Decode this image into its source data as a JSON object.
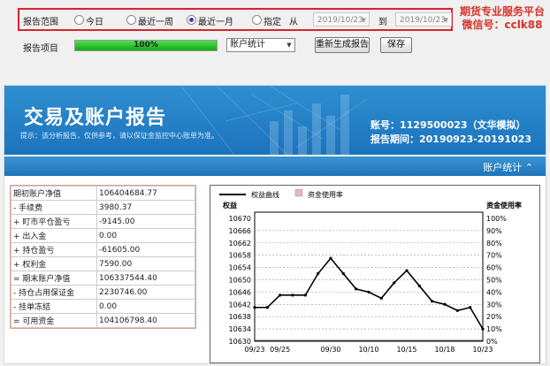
{
  "toolbar": {
    "range_label": "报告范围",
    "options": [
      {
        "label": "今日",
        "selected": false
      },
      {
        "label": "最近一周",
        "selected": false
      },
      {
        "label": "最近一月",
        "selected": true
      },
      {
        "label": "指定",
        "selected": false
      }
    ],
    "from_label": "从",
    "from_date": "2019/10/23",
    "to_label": "到",
    "to_date": "2019/10/23",
    "project_label": "报告项目",
    "progress_text": "100%",
    "progress": 1.0,
    "project_select": "账户统计",
    "regen_button": "重新生成报告",
    "save_button": "保存"
  },
  "watermark": {
    "line1": "期货专业服务平台",
    "line2": "微信号：cclk88"
  },
  "report": {
    "title": "交易及账户报告",
    "tip": "提示：该分析报告，仅供参考，请以保证金监控中心账单为准。",
    "account": "账号：1129500023（文华模拟）",
    "period": "报告期间：20190923-20191023",
    "section": "账户统计 ⌃"
  },
  "accounts": [
    {
      "k": "期初账户净值",
      "v": "106404684.77"
    },
    {
      "k": "- 手续费",
      "v": "3980.37"
    },
    {
      "k": "+ 盯市平仓盈亏",
      "v": "-9145.00"
    },
    {
      "k": "+ 出入金",
      "v": "0.00"
    },
    {
      "k": "+ 持仓盈亏",
      "v": "-61605.00"
    },
    {
      "k": "+ 权利金",
      "v": "7590.00"
    },
    {
      "k": "= 期末账户净值",
      "v": "106337544.40"
    },
    {
      "k": "- 持仓占用保证金",
      "v": "2230746.00"
    },
    {
      "k": "- 挂单冻结",
      "v": "0.00"
    },
    {
      "k": "= 可用资金",
      "v": "104106798.40"
    }
  ],
  "chart_data": {
    "type": "line",
    "legend": [
      "权益曲线",
      "资金使用率"
    ],
    "left_axis_label": "权益",
    "right_axis_label": "资金使用率",
    "ylim": [
      10630,
      10672
    ],
    "y_ticks": [
      10630,
      10634,
      10638,
      10642,
      10646,
      10650,
      10654,
      10658,
      10662,
      10666,
      10670
    ],
    "y2_ticks": [
      "0%",
      "10%",
      "20%",
      "30%",
      "40%",
      "50%",
      "60%",
      "70%",
      "80%",
      "90%",
      "100%"
    ],
    "x_tick_labels": [
      "09/23",
      "09/25",
      "09/30",
      "10/10",
      "10/15",
      "10/18",
      "10/23"
    ],
    "x_tick_index": [
      0,
      2,
      6,
      9,
      12,
      15,
      18
    ],
    "series": [
      {
        "name": "权益曲线",
        "values": [
          10641,
          10641,
          10645,
          10645,
          10645,
          10652,
          10657,
          10652,
          10647,
          10646,
          10644,
          10649,
          10653,
          10648,
          10643,
          10642,
          10640,
          10641,
          10634
        ]
      },
      {
        "name": "资金使用率",
        "values": [
          0,
          0,
          0,
          0,
          0,
          0,
          0,
          0,
          0,
          0,
          0,
          0,
          0,
          0,
          0,
          0,
          0,
          0,
          0
        ]
      }
    ]
  }
}
